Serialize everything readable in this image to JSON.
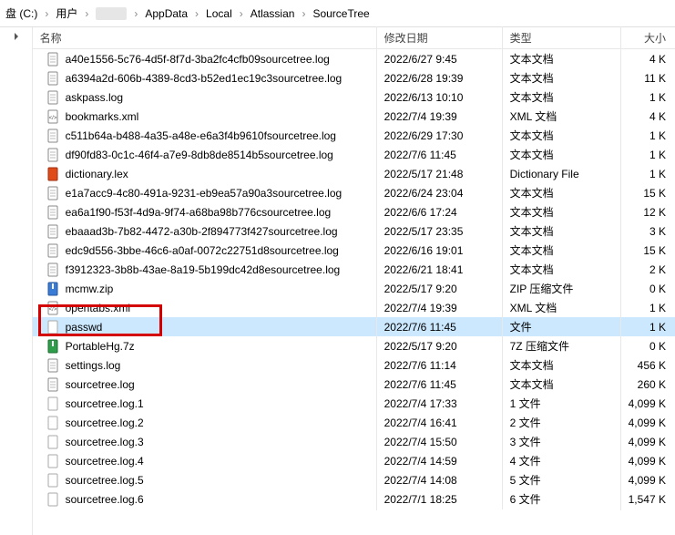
{
  "breadcrumb": {
    "items": [
      {
        "label": "盘 (C:)",
        "blur": false
      },
      {
        "label": "用户",
        "blur": false
      },
      {
        "label": "",
        "blur": true
      },
      {
        "label": "AppData",
        "blur": false
      },
      {
        "label": "Local",
        "blur": false
      },
      {
        "label": "Atlassian",
        "blur": false
      },
      {
        "label": "SourceTree",
        "blur": false
      }
    ],
    "sep": "›"
  },
  "columns": {
    "name": "名称",
    "date": "修改日期",
    "type": "类型",
    "size": "大小"
  },
  "highlight_index": 14,
  "files": [
    {
      "name": "a40e1556-5c76-4d5f-8f7d-3ba2fc4cfb09sourcetree.log",
      "date": "2022/6/27 9:45",
      "type": "文本文档",
      "size": "4 K",
      "icon": "text"
    },
    {
      "name": "a6394a2d-606b-4389-8cd3-b52ed1ec19c3sourcetree.log",
      "date": "2022/6/28 19:39",
      "type": "文本文档",
      "size": "11 K",
      "icon": "text"
    },
    {
      "name": "askpass.log",
      "date": "2022/6/13 10:10",
      "type": "文本文档",
      "size": "1 K",
      "icon": "text"
    },
    {
      "name": "bookmarks.xml",
      "date": "2022/7/4 19:39",
      "type": "XML 文档",
      "size": "4 K",
      "icon": "xml"
    },
    {
      "name": "c511b64a-b488-4a35-a48e-e6a3f4b9610fsourcetree.log",
      "date": "2022/6/29 17:30",
      "type": "文本文档",
      "size": "1 K",
      "icon": "text"
    },
    {
      "name": "df90fd83-0c1c-46f4-a7e9-8db8de8514b5sourcetree.log",
      "date": "2022/7/6 11:45",
      "type": "文本文档",
      "size": "1 K",
      "icon": "text"
    },
    {
      "name": "dictionary.lex",
      "date": "2022/5/17 21:48",
      "type": "Dictionary File",
      "size": "1 K",
      "icon": "lex"
    },
    {
      "name": "e1a7acc9-4c80-491a-9231-eb9ea57a90a3sourcetree.log",
      "date": "2022/6/24 23:04",
      "type": "文本文档",
      "size": "15 K",
      "icon": "text"
    },
    {
      "name": "ea6a1f90-f53f-4d9a-9f74-a68ba98b776csourcetree.log",
      "date": "2022/6/6 17:24",
      "type": "文本文档",
      "size": "12 K",
      "icon": "text"
    },
    {
      "name": "ebaaad3b-7b82-4472-a30b-2f894773f427sourcetree.log",
      "date": "2022/5/17 23:35",
      "type": "文本文档",
      "size": "3 K",
      "icon": "text"
    },
    {
      "name": "edc9d556-3bbe-46c6-a0af-0072c22751d8sourcetree.log",
      "date": "2022/6/16 19:01",
      "type": "文本文档",
      "size": "15 K",
      "icon": "text"
    },
    {
      "name": "f3912323-3b8b-43ae-8a19-5b199dc42d8esourcetree.log",
      "date": "2022/6/21 18:41",
      "type": "文本文档",
      "size": "2 K",
      "icon": "text"
    },
    {
      "name": "mcmw.zip",
      "date": "2022/5/17 9:20",
      "type": "ZIP 压缩文件",
      "size": "0 K",
      "icon": "zip"
    },
    {
      "name": "opentabs.xml",
      "date": "2022/7/4 19:39",
      "type": "XML 文档",
      "size": "1 K",
      "icon": "xml"
    },
    {
      "name": "passwd",
      "date": "2022/7/6 11:45",
      "type": "文件",
      "size": "1 K",
      "icon": "file",
      "selected": true
    },
    {
      "name": "PortableHg.7z",
      "date": "2022/5/17 9:20",
      "type": "7Z 压缩文件",
      "size": "0 K",
      "icon": "7z"
    },
    {
      "name": "settings.log",
      "date": "2022/7/6 11:14",
      "type": "文本文档",
      "size": "456 K",
      "icon": "text"
    },
    {
      "name": "sourcetree.log",
      "date": "2022/7/6 11:45",
      "type": "文本文档",
      "size": "260 K",
      "icon": "text"
    },
    {
      "name": "sourcetree.log.1",
      "date": "2022/7/4 17:33",
      "type": "1 文件",
      "size": "4,099 K",
      "icon": "file"
    },
    {
      "name": "sourcetree.log.2",
      "date": "2022/7/4 16:41",
      "type": "2 文件",
      "size": "4,099 K",
      "icon": "file"
    },
    {
      "name": "sourcetree.log.3",
      "date": "2022/7/4 15:50",
      "type": "3 文件",
      "size": "4,099 K",
      "icon": "file"
    },
    {
      "name": "sourcetree.log.4",
      "date": "2022/7/4 14:59",
      "type": "4 文件",
      "size": "4,099 K",
      "icon": "file"
    },
    {
      "name": "sourcetree.log.5",
      "date": "2022/7/4 14:08",
      "type": "5 文件",
      "size": "4,099 K",
      "icon": "file"
    },
    {
      "name": "sourcetree.log.6",
      "date": "2022/7/1 18:25",
      "type": "6 文件",
      "size": "1,547 K",
      "icon": "file"
    }
  ],
  "icons": {
    "text": "text-document-icon",
    "xml": "xml-document-icon",
    "file": "generic-file-icon",
    "zip": "zip-archive-icon",
    "7z": "7z-archive-icon",
    "lex": "office-file-icon"
  }
}
